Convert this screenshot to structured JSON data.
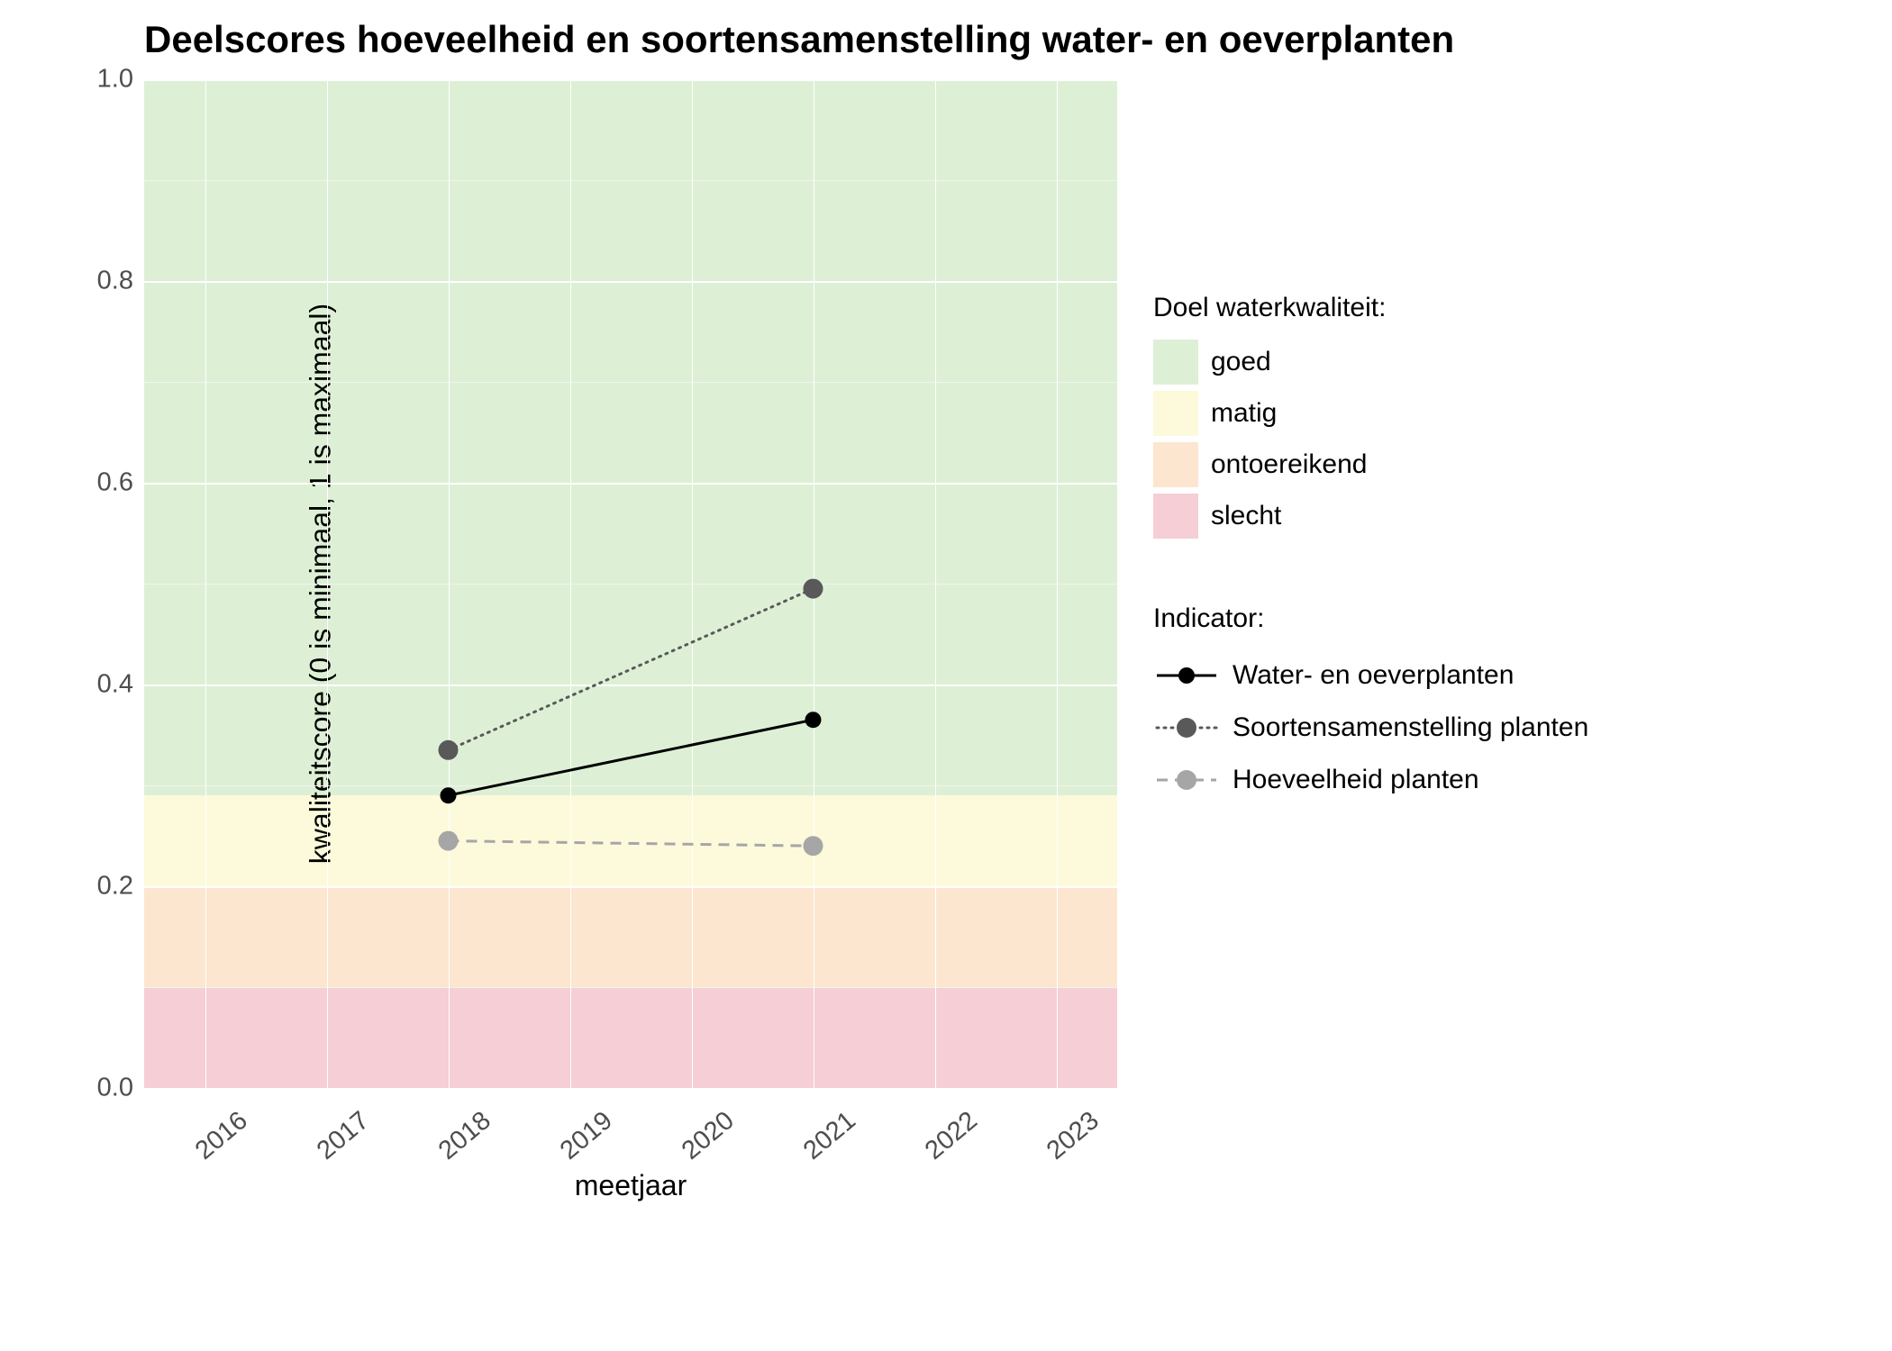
{
  "chart_data": {
    "type": "line",
    "title": "Deelscores hoeveelheid en soortensamenstelling water- en oeverplanten",
    "xlabel": "meetjaar",
    "ylabel": "kwaliteitscore (0 is minimaal, 1 is maximaal)",
    "x_range": [
      2015.5,
      2023.5
    ],
    "x_ticks": [
      2016,
      2017,
      2018,
      2019,
      2020,
      2021,
      2022,
      2023
    ],
    "y_range": [
      0.0,
      1.0
    ],
    "y_ticks": [
      0.0,
      0.2,
      0.4,
      0.6,
      0.8,
      1.0
    ],
    "bands": [
      {
        "name": "goed",
        "from": 0.29,
        "to": 1.0,
        "color": "#ddf0d5"
      },
      {
        "name": "matig",
        "from": 0.2,
        "to": 0.29,
        "color": "#fcfadb"
      },
      {
        "name": "ontoereikend",
        "from": 0.1,
        "to": 0.2,
        "color": "#fce6cf"
      },
      {
        "name": "slecht",
        "from": 0.0,
        "to": 0.1,
        "color": "#f6ced6"
      }
    ],
    "series": [
      {
        "name": "Water- en oeverplanten",
        "linestyle": "solid",
        "color": "#000000",
        "x": [
          2018,
          2021
        ],
        "y": [
          0.29,
          0.365
        ]
      },
      {
        "name": "Soortensamenstelling planten",
        "linestyle": "dotted",
        "color": "#595959",
        "x": [
          2018,
          2021
        ],
        "y": [
          0.335,
          0.495
        ]
      },
      {
        "name": "Hoeveelheid planten",
        "linestyle": "dashed",
        "color": "#A6A6A6",
        "x": [
          2018,
          2021
        ],
        "y": [
          0.245,
          0.24
        ]
      }
    ],
    "legend_quality_title": "Doel waterkwaliteit:",
    "legend_indicator_title": "Indicator:",
    "quality_labels": {
      "goed": "goed",
      "matig": "matig",
      "ontoereikend": "ontoereikend",
      "slecht": "slecht"
    },
    "indicator_labels": {
      "s1": "Water- en oeverplanten",
      "s2": "Soortensamenstelling planten",
      "s3": "Hoeveelheid planten"
    }
  }
}
